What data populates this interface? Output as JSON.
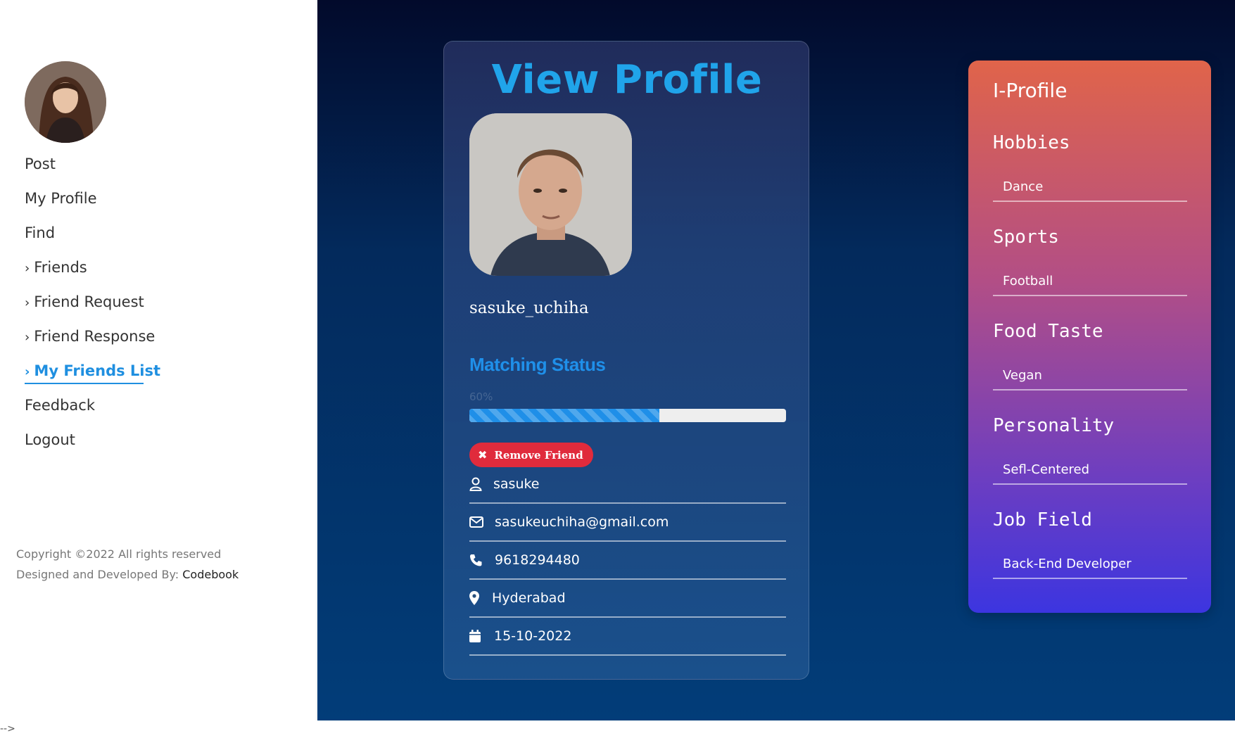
{
  "sidebar": {
    "nav": [
      {
        "label": "Post",
        "arrow": false,
        "active": false
      },
      {
        "label": "My Profile",
        "arrow": false,
        "active": false
      },
      {
        "label": "Find",
        "arrow": false,
        "active": false
      },
      {
        "label": "Friends",
        "arrow": true,
        "active": false
      },
      {
        "label": "Friend Request",
        "arrow": true,
        "active": false
      },
      {
        "label": "Friend Response",
        "arrow": true,
        "active": false
      },
      {
        "label": "My Friends List",
        "arrow": true,
        "active": true
      },
      {
        "label": "Feedback",
        "arrow": false,
        "active": false
      },
      {
        "label": "Logout",
        "arrow": false,
        "active": false
      }
    ],
    "copyright_line1": "Copyright ©2022 All rights reserved",
    "copyright_line2": "Designed and Developed By: ",
    "brand": "Codebook"
  },
  "card": {
    "title": "View Profile",
    "username": "sasuke_uchiha",
    "matching_title": "Matching Status",
    "matching_percent_label": "60%",
    "matching_percent": 60,
    "remove_label": "Remove Friend",
    "info": {
      "name": "sasuke",
      "email": "sasukeuchiha@gmail.com",
      "phone": "9618294480",
      "location": "Hyderabad",
      "date": "15-10-2022"
    }
  },
  "iprofile": {
    "title": "I-Profile",
    "sections": [
      {
        "label": "Hobbies",
        "value": "Dance"
      },
      {
        "label": "Sports",
        "value": "Football"
      },
      {
        "label": "Food Taste",
        "value": "Vegan"
      },
      {
        "label": "Personality",
        "value": "Sefl-Centered"
      },
      {
        "label": "Job Field",
        "value": "Back-End Developer"
      }
    ]
  },
  "stray_text": "-->",
  "colors": {
    "accent": "#1f8fe0",
    "remove": "#e02b3c",
    "panel_top": "#e0644a",
    "panel_bottom": "#3c35e0"
  }
}
